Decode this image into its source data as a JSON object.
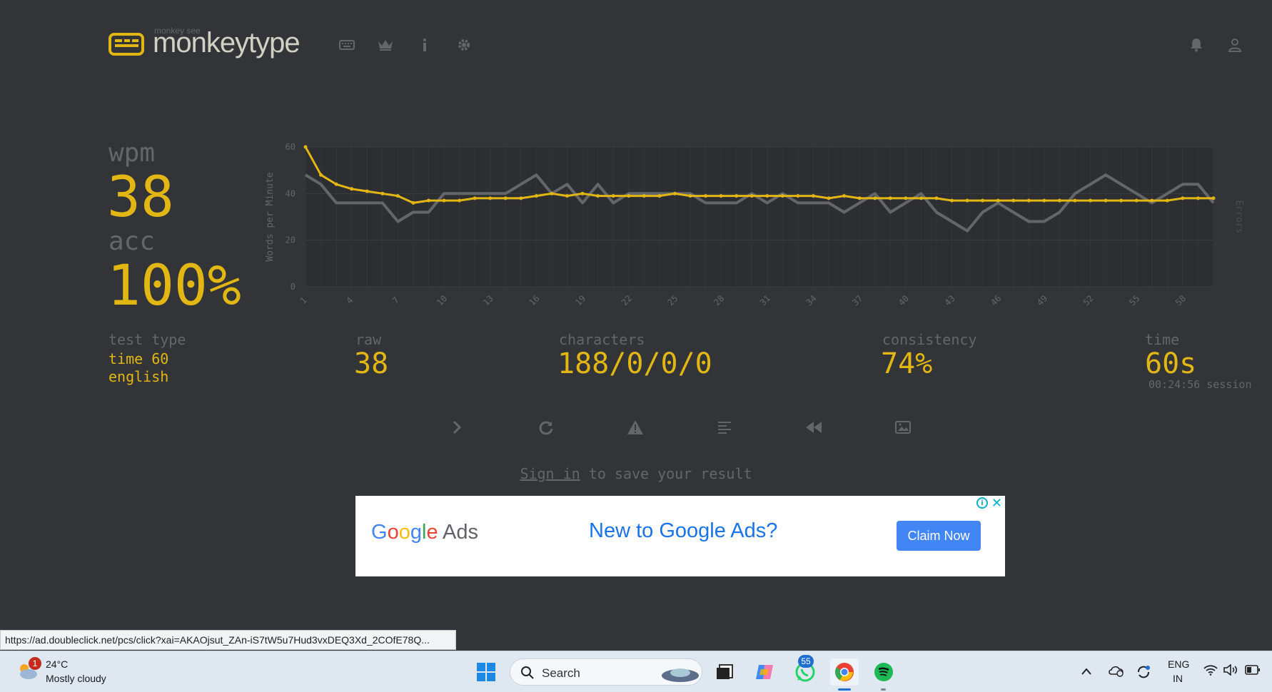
{
  "header": {
    "tagline": "monkey see",
    "brand": "monkeytype",
    "nav_icons": [
      "keyboard-icon",
      "crown-icon",
      "info-icon",
      "gear-icon"
    ],
    "right_icons": [
      "bell-icon",
      "user-icon"
    ]
  },
  "stats": {
    "wpm_label": "wpm",
    "wpm_value": "38",
    "acc_label": "acc",
    "acc_value": "100%",
    "test_type_label": "test type",
    "test_type_value": "time 60",
    "language": "english",
    "raw_label": "raw",
    "raw_value": "38",
    "characters_label": "characters",
    "characters_value": "188/0/0/0",
    "consistency_label": "consistency",
    "consistency_value": "74%",
    "time_label": "time",
    "time_value": "60s",
    "session_text": "00:24:56 session"
  },
  "chart_data": {
    "type": "line",
    "ylabel": "Words per Minute",
    "y2label": "Errors",
    "ylim": [
      0,
      60
    ],
    "yticks": [
      0,
      20,
      40,
      60
    ],
    "xticks": [
      1,
      4,
      7,
      10,
      13,
      16,
      19,
      22,
      25,
      28,
      31,
      34,
      37,
      40,
      43,
      46,
      49,
      52,
      55,
      58
    ],
    "x": [
      1,
      2,
      3,
      4,
      5,
      6,
      7,
      8,
      9,
      10,
      11,
      12,
      13,
      14,
      15,
      16,
      17,
      18,
      19,
      20,
      21,
      22,
      23,
      24,
      25,
      26,
      27,
      28,
      29,
      30,
      31,
      32,
      33,
      34,
      35,
      36,
      37,
      38,
      39,
      40,
      41,
      42,
      43,
      44,
      45,
      46,
      47,
      48,
      49,
      50,
      51,
      52,
      53,
      54,
      55,
      56,
      57,
      58,
      59,
      60
    ],
    "series": [
      {
        "color": "#e2b714",
        "values": [
          60,
          48,
          44,
          42,
          41,
          40,
          39,
          36,
          37,
          37,
          37,
          38,
          38,
          38,
          38,
          39,
          40,
          39,
          40,
          39,
          39,
          39,
          39,
          39,
          40,
          39,
          39,
          39,
          39,
          39,
          39,
          39,
          39,
          39,
          38,
          39,
          38,
          38,
          38,
          38,
          38,
          38,
          37,
          37,
          37,
          37,
          37,
          37,
          37,
          37,
          37,
          37,
          37,
          37,
          37,
          37,
          37,
          38,
          38,
          38
        ]
      },
      {
        "color": "#646669",
        "values": [
          48,
          44,
          36,
          36,
          36,
          36,
          28,
          32,
          32,
          40,
          40,
          40,
          40,
          40,
          44,
          48,
          40,
          44,
          36,
          44,
          36,
          40,
          40,
          40,
          40,
          40,
          36,
          36,
          36,
          40,
          36,
          40,
          36,
          36,
          36,
          32,
          36,
          40,
          32,
          36,
          40,
          32,
          28,
          24,
          32,
          36,
          32,
          28,
          28,
          32,
          40,
          44,
          48,
          44,
          40,
          36,
          40,
          44,
          44,
          36
        ]
      }
    ]
  },
  "actions": [
    "next-test-icon",
    "restart-icon",
    "report-icon",
    "word-history-icon",
    "replay-icon",
    "screenshot-icon"
  ],
  "signin": {
    "link": "Sign in",
    "rest": " to save your result"
  },
  "ad": {
    "logo_text": "Google Ads",
    "headline": "New to Google Ads?",
    "button": "Claim Now",
    "info": "i",
    "close": "✕"
  },
  "status_url": "https://ad.doubleclick.net/pcs/click?xai=AKAOjsut_ZAn-iS7tW5u7Hud3vxDEQ3Xd_2COfE78Q...",
  "taskbar": {
    "weather_badge": "1",
    "weather_temp": "24°C",
    "weather_desc": "Mostly cloudy",
    "search_label": "Search",
    "whatsapp_badge": "55",
    "lang_line1": "ENG",
    "lang_line2": "IN"
  }
}
